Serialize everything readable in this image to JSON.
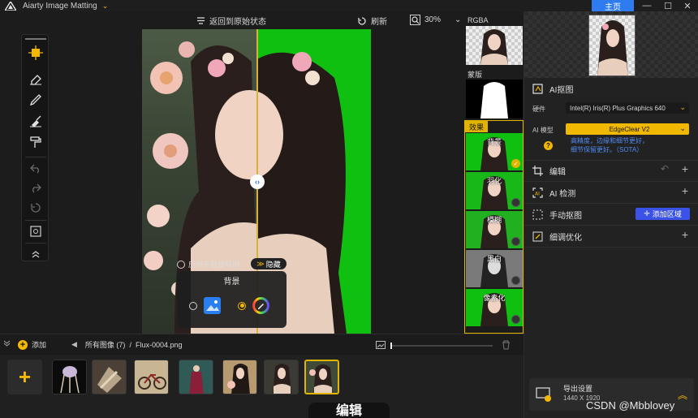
{
  "app": {
    "title": "Aiarty Image Matting",
    "home_label": "主页"
  },
  "canvas_toolbar": {
    "reset_label": "返回到原始状态",
    "refresh_label": "刷新",
    "zoom": "30%"
  },
  "canvas": {
    "batch_export_label": "应用于批量导出",
    "hide_label": "隐藏",
    "bg_title": "背景"
  },
  "preview": {
    "rgba_label": "RGBA",
    "mask_label": "蒙版",
    "effects_label": "效果",
    "effects": [
      {
        "label": "背景",
        "checked": true
      },
      {
        "label": "羽化",
        "checked": false
      },
      {
        "label": "模糊",
        "checked": false
      },
      {
        "label": "黑白",
        "checked": false
      },
      {
        "label": "像素化",
        "checked": false
      }
    ]
  },
  "right_panel": {
    "ai_matting_title": "AI抠图",
    "hardware_label": "硬件",
    "hardware_value": "Intel(R) Iris(R) Plus Graphics 640",
    "model_label": "AI 模型",
    "model_value": "EdgeClear  V2",
    "model_desc_line1": "高精度，边缘和细节更好，",
    "model_desc_line2": "细节保留更好。（SOTA）",
    "edit_label": "编辑",
    "detect_label": "AI 检测",
    "manual_label": "手动抠图",
    "add_region_label": "添加区域",
    "refine_label": "细调优化",
    "export_title": "导出设置",
    "export_info": "1440 X 1920"
  },
  "bottom": {
    "add_label": "添加",
    "breadcrumb_all": "所有图像 (7)",
    "separator": "/",
    "filename": "Flux-0004.png",
    "edit_tab_label": "编辑"
  },
  "watermark": "CSDN @Mbblovey",
  "colors": {
    "accent": "#e0b400",
    "primary": "#2f7bf0",
    "green_bg": "#10c010"
  }
}
